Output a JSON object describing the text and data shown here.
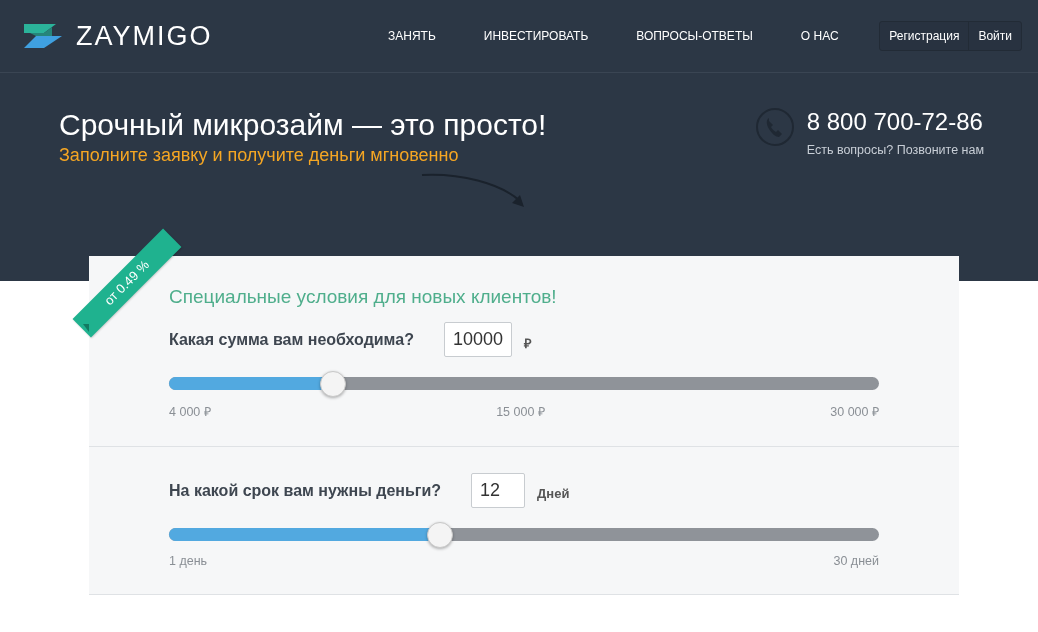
{
  "header": {
    "logo": "ZAYMIGO",
    "nav": [
      "ЗАНЯТЬ",
      "ИНВЕСТИРОВАТЬ",
      "ВОПРОСЫ-ОТВЕТЫ",
      "О НАС"
    ],
    "auth_buttons": [
      "Регистрация",
      "Войти"
    ]
  },
  "hero": {
    "title": "Срочный микрозайм — это просто!",
    "subtitle": "Заполните заявку и получите деньги мгновенно",
    "phone": "8 800 700-72-86",
    "phone_note": "Есть вопросы? Позвоните нам"
  },
  "calculator": {
    "ribbon": "от 0.49 %",
    "heading": "Специальные условия для новых клиентов!",
    "sliders": [
      {
        "question": "Какая сумма вам необходима?",
        "value": "10000",
        "unit": "₽",
        "level": 0.23,
        "scale": [
          "4 000 ₽",
          "15 000 ₽",
          "30 000 ₽"
        ]
      },
      {
        "question": "На какой срок вам нужны деньги?",
        "value": "12",
        "unit": "Дней",
        "level": 0.38,
        "scale": [
          "1 день",
          "30 дней"
        ]
      }
    ]
  }
}
